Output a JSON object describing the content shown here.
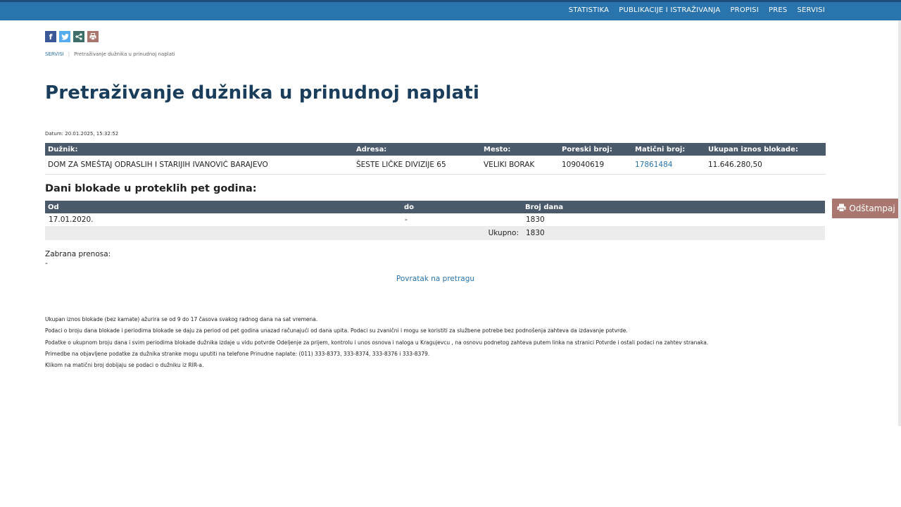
{
  "topnav": [
    "STATISTIKA",
    "PUBLIKACIJE I ISTRAŽIVANJA",
    "PROPISI",
    "PRES",
    "SERVISI"
  ],
  "share_icons": [
    {
      "name": "facebook-icon",
      "glyph": "f",
      "color": "#3b5998"
    },
    {
      "name": "twitter-icon",
      "glyph": "t",
      "color": "#55acee"
    },
    {
      "name": "share-icon",
      "glyph": "<",
      "color": "#3d6e6a"
    },
    {
      "name": "print-small-icon",
      "glyph": "⎙",
      "color": "#a9776f"
    }
  ],
  "breadcrumb": {
    "root": "SERVISI",
    "current": "Pretraživanje dužnika u prinudnoj naplati"
  },
  "page": {
    "title": "Pretraživanje dužnika u prinudnoj naplati",
    "datum": "Datum: 20.01.2025, 15:32:52"
  },
  "debtor_table": {
    "headers": [
      "Dužnik:",
      "Adresa:",
      "Mesto:",
      "Poreski broj:",
      "Matični broj:",
      "Ukupan iznos blokade:"
    ],
    "row": {
      "name": "DOM ZA SMEŠTAJ ODRASLIH I STARIJIH IVANOVIĆ BARAJEVO",
      "address": "ŠESTE LIČKE DIVIZIJE 65",
      "place": "VELIKI BORAK",
      "tax_no": "109040619",
      "reg_no": "17861484",
      "amount": "11.646.280,50"
    }
  },
  "blockade": {
    "title": "Dani blokade u proteklih pet godina:",
    "headers": [
      "Od",
      "do",
      "Broj dana"
    ],
    "rows": [
      {
        "from": "17.01.2020.",
        "to": "-",
        "days": "1830"
      }
    ],
    "total_label": "Ukupno:",
    "total": "1830"
  },
  "zabrana": {
    "label": "Zabrana prenosa:",
    "value": "-"
  },
  "back_link": "Povratak na pretragu",
  "notes": [
    "Ukupan iznos blokade (bez kamate) ažurira se od 9 do 17 časova svakog radnog dana na sat vremena.",
    "Podaci o broju dana blokade i periodima blokade se daju za period od pet godina unazad računajući od dana upita. Podaci su zvanični i mogu se koristiti za službene potrebe bez podnošenja zahteva da izdavanje potvrde.",
    "Podatke o ukupnom broju dana i svim periodima blokade dužnika izdaje u vidu potvrde Odeljenje za prijem, kontrolu i unos osnova i naloga u Kragujevcu , na osnovu podnetog zahteva putem linka na stranici Potvrde i ostali podaci na zahtev stranaka.",
    "Primedbe na objavljene podatke za dužnika stranke mogu uputiti na telefone Prinudne naplate: (011) 333-8373, 333-8374, 333-8376 i 333-8379.",
    "Klikom na matični broj dobijaju se podaci o dužniku iz RIR-a."
  ],
  "print_button": {
    "label": "Odštampaj"
  }
}
